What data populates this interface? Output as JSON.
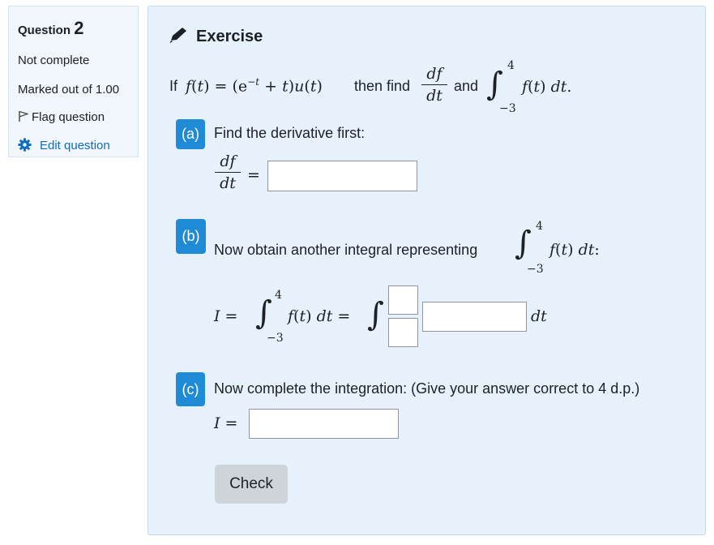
{
  "info": {
    "question_label": "Question",
    "question_number": "2",
    "state": "Not complete",
    "marked": "Marked out of 1.00",
    "flag_label": "Flag question",
    "edit_label": "Edit question"
  },
  "exercise": {
    "title": "Exercise",
    "intro_if": "If",
    "intro_then": "then find",
    "intro_and": "and",
    "function_def": "f(t) = (e−t + t)u(t)",
    "upper_limit": "4",
    "lower_limit": "−3",
    "integrand": "f(t) dt."
  },
  "part_a": {
    "badge": "(a)",
    "prompt": "Find the derivative first:",
    "lhs_num": "df",
    "lhs_den": "dt",
    "answer_value": ""
  },
  "part_b": {
    "badge": "(b)",
    "prompt": "Now obtain another integral representing",
    "integrand": "f(t) dt:",
    "lhs": "I =",
    "middle": "f(t) dt =",
    "dt_label": "dt",
    "upper_value": "",
    "lower_value": "",
    "integrand_value": ""
  },
  "part_c": {
    "badge": "(c)",
    "prompt": "Now complete the integration: (Give your answer correct to 4 d.p.)",
    "lhs": "I =",
    "answer_value": ""
  },
  "check_label": "Check",
  "colors": {
    "badge": "#1f8bd6",
    "link": "#0f6cbf",
    "panel_bg": "#e7f1fb"
  }
}
